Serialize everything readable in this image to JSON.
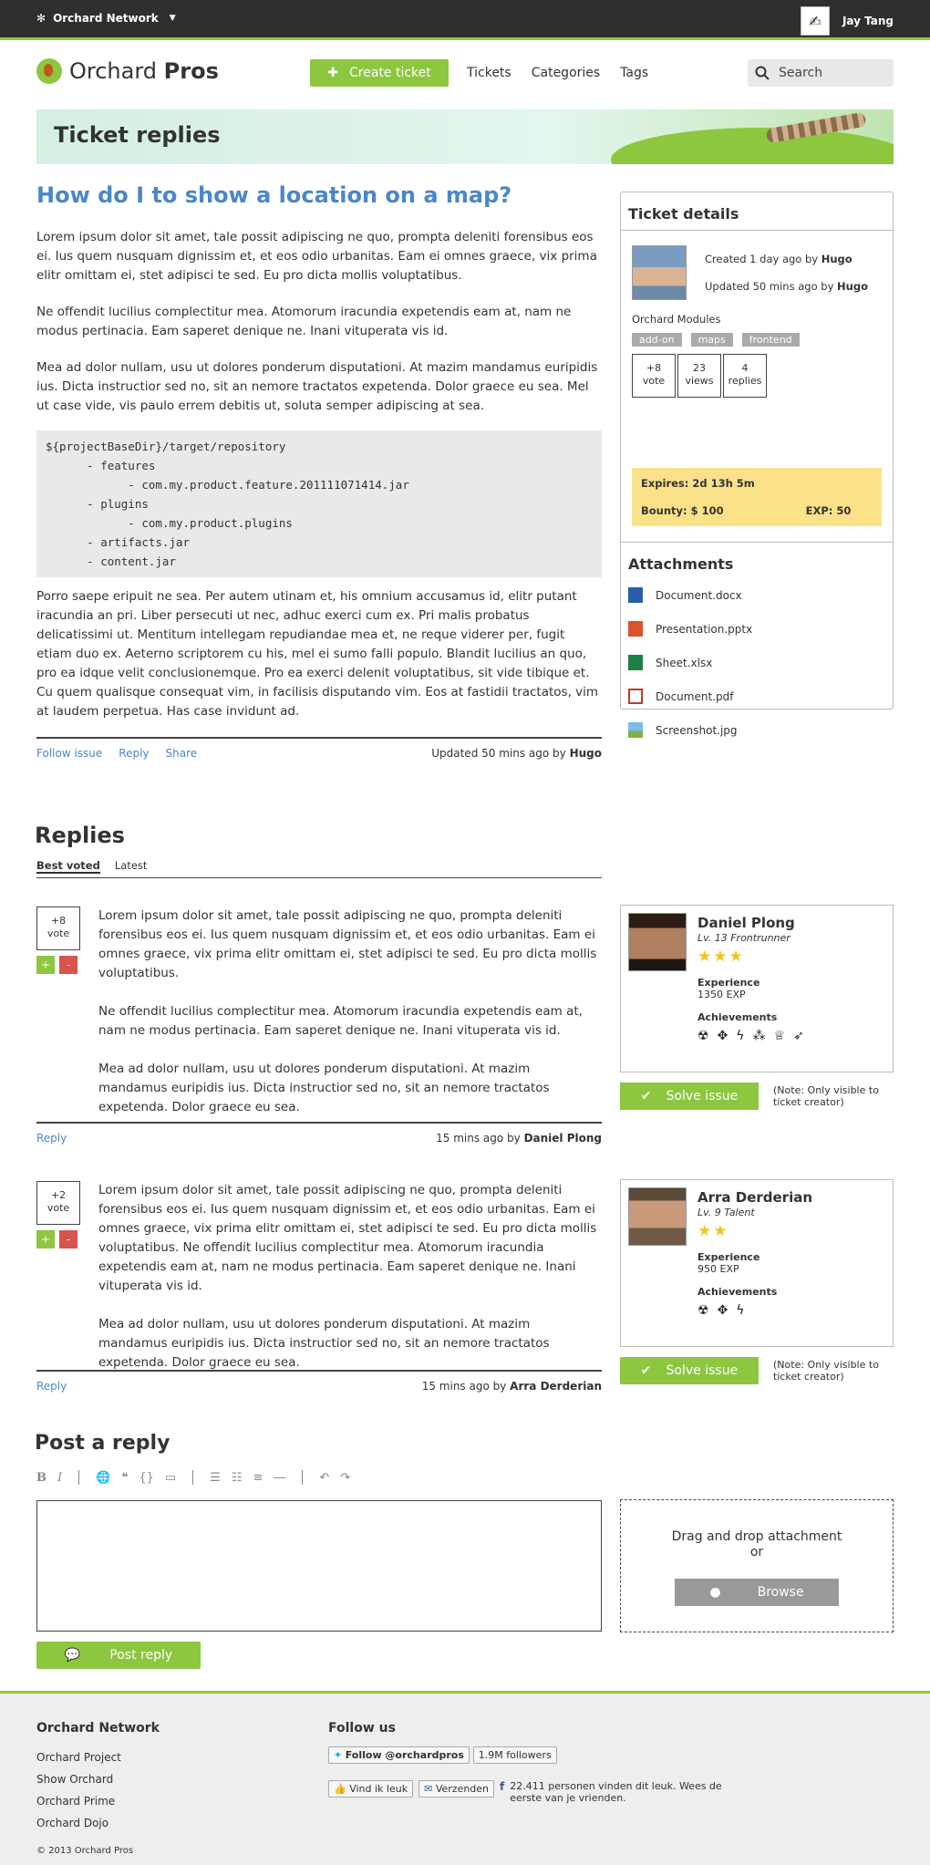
{
  "topbar": {
    "network": "Orchard Network",
    "user_name": "Jay Tang"
  },
  "header": {
    "logo_light": "Orchard",
    "logo_bold": "Pros",
    "create_ticket": "Create ticket",
    "nav": [
      "Tickets",
      "Categories",
      "Tags"
    ],
    "search_placeholder": "Search"
  },
  "banner": {
    "title": "Ticket replies"
  },
  "question": {
    "title": "How do I to show a location on a map?",
    "paragraphs": [
      "Lorem ipsum dolor sit amet, tale possit adipiscing ne quo, prompta deleniti forensibus eos ei. Ius quem nusquam dignissim et, et eos odio urbanitas. Eam ei omnes graece, vix prima elitr omittam ei, stet adipisci te sed. Eu pro dicta mollis voluptatibus.",
      "Ne offendit lucilius complectitur mea. Atomorum iracundia expetendis eam at, nam ne modus pertinacia. Eam saperet denique ne. Inani vituperata vis id.",
      "Mea ad dolor nullam, usu ut dolores ponderum disputationi. At mazim mandamus euripidis ius. Dicta instructior sed no, sit an nemore tractatos expetenda. Dolor graece eu sea. Mel ut case vide, vis paulo errem debitis ut, soluta semper adipiscing at sea."
    ],
    "code": "${projectBaseDir}/target/repository\n      - features\n            - com.my.product.feature.201111071414.jar\n      - plugins\n            - com.my.product.plugins\n      - artifacts.jar\n      - content.jar",
    "closing": "Porro saepe eripuit ne sea. Per autem utinam et, his omnium accusamus id, elitr putant iracundia an pri. Liber persecuti ut nec, adhuc exerci cum ex. Pri malis probatus delicatissimi ut. Mentitum intellegam repudiandae mea et, ne reque viderer per, fugit etiam duo ex. Aeterno scriptorem cu his, mel ei sumo falli populo. Blandit lucilius an quo, pro ea idque velit conclusionemque. Pro ea exerci delenit voluptatibus, sit vide tibique et. Cu quem qualisque consequat vim, in facilisis disputando vim. Eos at fastidii tractatos, vim at laudem perpetua. Has case invidunt ad.",
    "links": [
      "Follow issue",
      "Reply",
      "Share"
    ],
    "updated": "Updated 50 mins ago by",
    "updated_by": "Hugo"
  },
  "details": {
    "title": "Ticket details",
    "created": "Created 1 day ago by",
    "created_by": "Hugo",
    "updated": "Updated 50 mins ago by",
    "updated_by": "Hugo",
    "module": "Orchard Modules",
    "tags": [
      "add-on",
      "maps",
      "frontend"
    ],
    "stats": [
      {
        "num": "+8",
        "label": "vote"
      },
      {
        "num": "23",
        "label": "views"
      },
      {
        "num": "4",
        "label": "replies"
      }
    ],
    "expires": "Expires: 2d 13h 5m",
    "bounty": "Bounty: $ 100",
    "exp": "EXP: 50",
    "attachments_title": "Attachments",
    "attachments": [
      {
        "name": "Document.docx",
        "icon": "word-icon"
      },
      {
        "name": "Presentation.pptx",
        "icon": "powerpoint-icon"
      },
      {
        "name": "Sheet.xlsx",
        "icon": "excel-icon"
      },
      {
        "name": "Document.pdf",
        "icon": "pdf-icon"
      },
      {
        "name": "Screenshot.jpg",
        "icon": "image-icon"
      }
    ]
  },
  "replies": {
    "title": "Replies",
    "tabs": [
      "Best voted",
      "Latest"
    ],
    "items": [
      {
        "vote": "+8",
        "vote_label": "vote",
        "paragraphs": [
          "Lorem ipsum dolor sit amet, tale possit adipiscing ne quo, prompta deleniti forensibus eos ei. Ius quem nusquam dignissim et, et eos odio urbanitas. Eam ei omnes graece, vix prima elitr omittam ei, stet adipisci te sed. Eu pro dicta mollis voluptatibus.",
          "Ne offendit lucilius complectitur mea. Atomorum iracundia expetendis eam at, nam ne modus pertinacia. Eam saperet denique ne. Inani vituperata vis id.",
          "Mea ad dolor nullam, usu ut dolores ponderum disputationi. At mazim mandamus euripidis ius. Dicta instructior sed no, sit an nemore tractatos expetenda. Dolor graece eu sea."
        ],
        "reply": "Reply",
        "time": "15 mins ago by",
        "author": "Daniel Plong",
        "card": {
          "name": "Daniel Plong",
          "level": "Lv. 13 Frontrunner",
          "stars": 3,
          "exp_label": "Experience",
          "exp": "1350 EXP",
          "ach_label": "Achievements",
          "achievements": [
            "radiation-icon",
            "crosshair-icon",
            "bolt-icon",
            "stars-icon",
            "trophy-icon",
            "rocket-icon"
          ]
        },
        "solve": "Solve issue",
        "note": "(Note: Only visible to ticket creator)"
      },
      {
        "vote": "+2",
        "vote_label": "vote",
        "paragraphs": [
          "Lorem ipsum dolor sit amet, tale possit adipiscing ne quo, prompta deleniti forensibus eos ei. Ius quem nusquam dignissim et, et eos odio urbanitas. Eam ei omnes graece, vix prima elitr omittam ei, stet adipisci te sed. Eu pro dicta mollis voluptatibus. Ne offendit lucilius complectitur mea. Atomorum iracundia expetendis eam at, nam ne modus pertinacia. Eam saperet denique ne. Inani vituperata vis id.",
          "Mea ad dolor nullam, usu ut dolores ponderum disputationi. At mazim mandamus euripidis ius. Dicta instructior sed no, sit an nemore tractatos expetenda. Dolor graece eu sea."
        ],
        "reply": "Reply",
        "time": "15 mins ago by",
        "author": "Arra Derderian",
        "card": {
          "name": "Arra Derderian",
          "level": "Lv. 9 Talent",
          "stars": 2,
          "exp_label": "Experience",
          "exp": "950 EXP",
          "ach_label": "Achievements",
          "achievements": [
            "radiation-icon",
            "crosshair-icon",
            "bolt-icon"
          ]
        },
        "solve": "Solve issue",
        "note": "(Note: Only visible to ticket creator)"
      }
    ]
  },
  "post": {
    "title": "Post a reply",
    "drop_line1": "Drag and drop attachment",
    "drop_line2": "or",
    "browse": "Browse",
    "submit": "Post reply"
  },
  "footer": {
    "network_title": "Orchard Network",
    "links": [
      "Orchard Project",
      "Show Orchard",
      "Orchard Prime",
      "Orchard Dojo"
    ],
    "follow_title": "Follow us",
    "twitter": "Follow @orchardpros",
    "followers": "1.9M followers",
    "like": "Vind ik leuk",
    "send": "Verzenden",
    "fb_text": "22.411 personen vinden dit leuk. Wees de eerste van je vrienden.",
    "copyright": "© 2013 Orchard Pros"
  }
}
